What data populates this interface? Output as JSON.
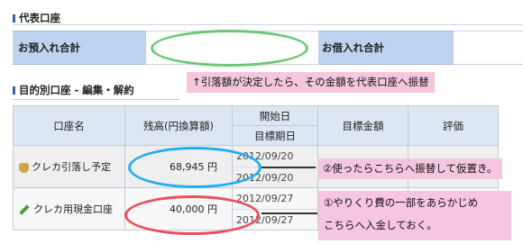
{
  "section1": {
    "title": "代表口座"
  },
  "summary": {
    "deposit_label": "お預入れ合計",
    "loan_label": "お借入れ合計"
  },
  "section2": {
    "title": "目的別口座 - 編集・解約"
  },
  "table": {
    "headers": {
      "name": "口座名",
      "balance": "残高(円換算額)",
      "start_date": "開始日",
      "target_date": "目標期日",
      "target_amount": "目標金額",
      "rating": "評価"
    },
    "rows": [
      {
        "name": "クレカ引落し予定",
        "balance": "68,945 円",
        "start_date": "2012/09/20",
        "target_date": "2012/09/20"
      },
      {
        "name": "クレカ用現金口座",
        "balance": "40,000 円",
        "start_date": "2012/09/27",
        "target_date": "2012/09/27"
      }
    ]
  },
  "annotations": {
    "top": "↑引落額が決定したら、その金額を代表口座へ振替",
    "mid": "②使ったらこちらへ振替して仮置き。",
    "bottom_line1": "①やりくり費の一部をあらかじめ",
    "bottom_line2": "こちらへ入金しておく。"
  },
  "colors": {
    "green_ellipse": "#6cc777",
    "blue_ellipse": "#22aef0",
    "red_ellipse": "#e8505b",
    "callout": "#f5c6de"
  }
}
